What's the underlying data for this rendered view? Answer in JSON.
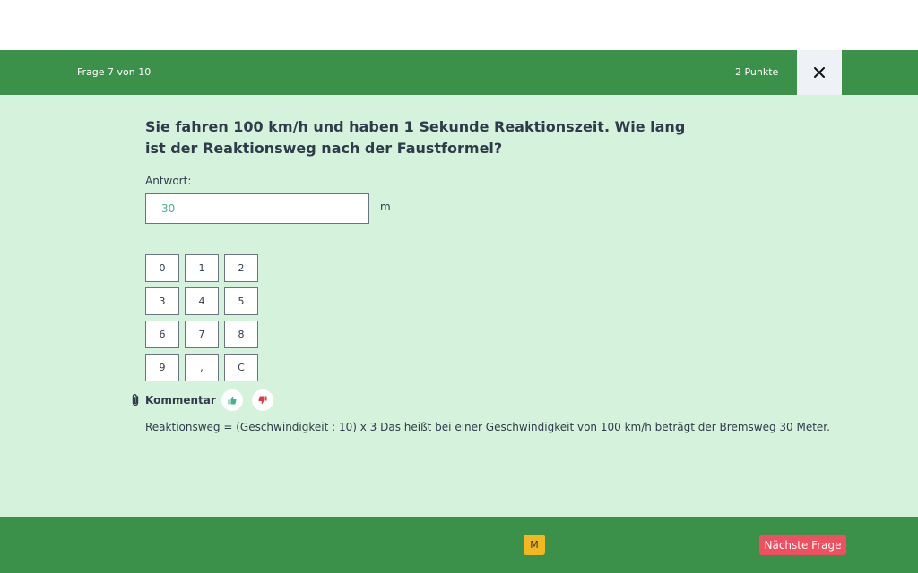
{
  "header": {
    "progress": "Frage 7 von 10",
    "points": "2 Punkte",
    "close_icon": "close-icon"
  },
  "question": {
    "text": "Sie fahren 100 km/h und haben 1 Sekunde Reaktionszeit. Wie lang ist der Reaktionsweg nach der Faustformel?",
    "answer_label": "Antwort:",
    "answer_value": "30",
    "unit": "m"
  },
  "keypad": {
    "keys": [
      "0",
      "1",
      "2",
      "3",
      "4",
      "5",
      "6",
      "7",
      "8",
      "9",
      ",",
      "C"
    ]
  },
  "comment": {
    "label": "Kommentar",
    "icons": [
      "paperclip-icon",
      "thumbs-up-icon",
      "thumbs-down-icon"
    ],
    "explanation": "Reaktionsweg = (Geschwindigkeit : 10) x 3 Das heißt bei einer Geschwindigkeit von 100 km/h beträgt der Bremsweg 30 Meter."
  },
  "footer": {
    "mark_label": "M",
    "next_label": "Nächste Frage"
  },
  "colors": {
    "header_green": "#3b914a",
    "content_background": "#d5f3dc",
    "answer_text": "#3fb58a",
    "next_button": "#ef4f5f",
    "mark_button": "#f2b820",
    "thumbs_up": "#3fb58a",
    "thumbs_down": "#e0394d"
  }
}
